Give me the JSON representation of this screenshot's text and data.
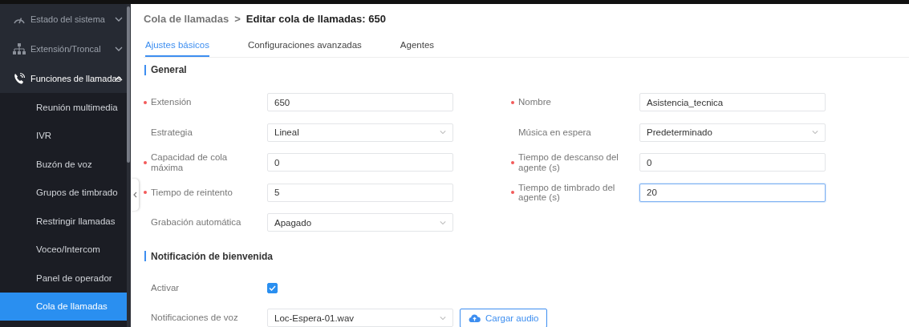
{
  "sidebar": {
    "items": [
      {
        "label": "Estado del sistema",
        "expanded": false
      },
      {
        "label": "Extensión/Troncal",
        "expanded": false
      },
      {
        "label": "Funciones de llamadas",
        "expanded": true,
        "children": [
          {
            "label": "Reunión multimedia",
            "selected": false
          },
          {
            "label": "IVR",
            "selected": false
          },
          {
            "label": "Buzón de voz",
            "selected": false
          },
          {
            "label": "Grupos de timbrado",
            "selected": false
          },
          {
            "label": "Restringir llamadas",
            "selected": false
          },
          {
            "label": "Voceo/Intercom",
            "selected": false
          },
          {
            "label": "Panel de operador",
            "selected": false
          },
          {
            "label": "Cola de llamadas",
            "selected": true
          }
        ]
      }
    ]
  },
  "breadcrumb": {
    "parent": "Cola de llamadas",
    "separator": ">",
    "current": "Editar cola de llamadas: 650"
  },
  "tabs": [
    {
      "label": "Ajustes básicos",
      "selected": true
    },
    {
      "label": "Configuraciones avanzadas",
      "selected": false
    },
    {
      "label": "Agentes",
      "selected": false
    }
  ],
  "sections": [
    {
      "title": "General",
      "fields": [
        {
          "label": "Extensión",
          "kind": "input",
          "required": true,
          "value": "650",
          "focused": false
        },
        {
          "label": "Nombre",
          "kind": "input",
          "required": true,
          "value": "Asistencia_tecnica",
          "focused": false
        },
        {
          "label": "Estrategia",
          "kind": "select",
          "required": false,
          "value": "Lineal",
          "focused": false
        },
        {
          "label": "Música en espera",
          "kind": "select",
          "required": false,
          "value": "Predeterminado",
          "focused": false
        },
        {
          "label": "Capacidad de cola máxima",
          "kind": "input",
          "required": true,
          "value": "0",
          "focused": false
        },
        {
          "label": "Tiempo de descanso del agente (s)",
          "kind": "input",
          "required": true,
          "value": "0",
          "focused": false
        },
        {
          "label": "Tiempo de reintento",
          "kind": "input",
          "required": true,
          "value": "5",
          "focused": false
        },
        {
          "label": "Tiempo de timbrado del agente (s)",
          "kind": "input",
          "required": true,
          "value": "20",
          "focused": true
        },
        {
          "label": "Grabación automática",
          "kind": "select",
          "required": false,
          "value": "Apagado",
          "focused": false
        }
      ]
    },
    {
      "title": "Notificación de bienvenida",
      "fields": [
        {
          "label": "Activar",
          "kind": "checkbox",
          "required": false,
          "checked": true
        },
        {
          "label": "Notificaciones de voz",
          "kind": "select",
          "required": false,
          "value": "Loc-Espera-01.wav",
          "focused": false,
          "button": "Cargar audio"
        }
      ]
    }
  ]
}
